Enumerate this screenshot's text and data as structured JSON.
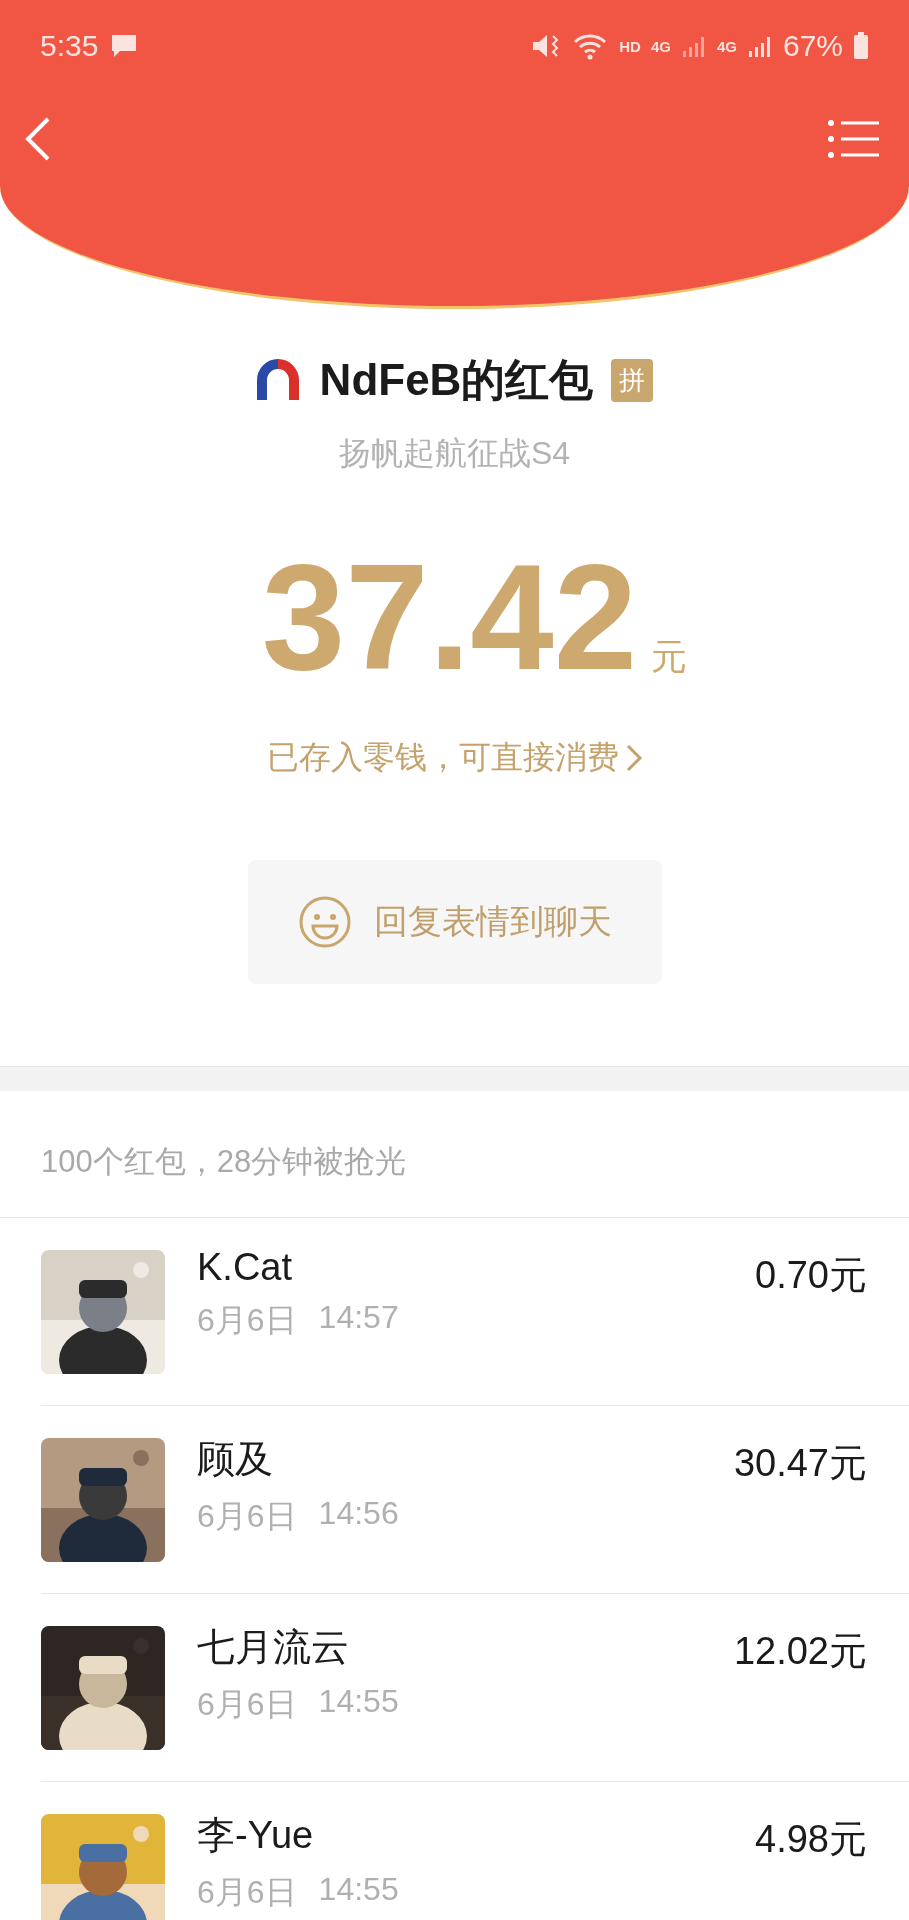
{
  "status_bar": {
    "time": "5:35",
    "network_labels": [
      "HD",
      "4G",
      "4G"
    ],
    "battery": "67%"
  },
  "sender": {
    "name": "NdFeB的红包",
    "badge": "拼",
    "blessing": "扬帆起航征战S4"
  },
  "amount": {
    "value": "37.42",
    "unit": "元",
    "note": "已存入零钱，可直接消费"
  },
  "reply_button": {
    "label": "回复表情到聊天"
  },
  "summary": "100个红包，28分钟被抢光",
  "records": [
    {
      "name": "K.Cat",
      "date": "6月6日",
      "time": "14:57",
      "amount": "0.70元"
    },
    {
      "name": "顾及",
      "date": "6月6日",
      "time": "14:56",
      "amount": "30.47元"
    },
    {
      "name": "七月流云",
      "date": "6月6日",
      "time": "14:55",
      "amount": "12.02元"
    },
    {
      "name": "李-Yue",
      "date": "6月6日",
      "time": "14:55",
      "amount": "4.98元"
    }
  ]
}
